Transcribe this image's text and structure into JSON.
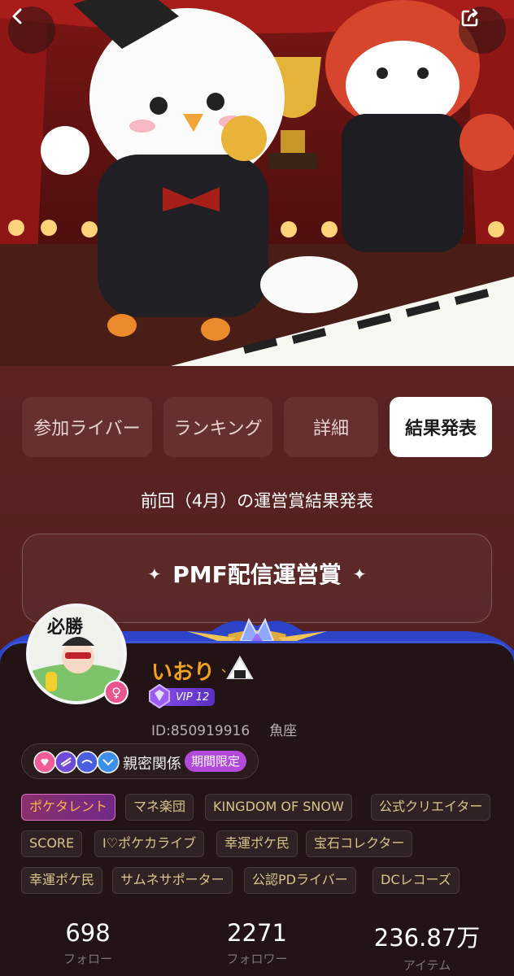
{
  "header": {
    "back_icon": "chevron-left-icon",
    "share_icon": "share-icon"
  },
  "tabs": [
    {
      "label": "参加ライバー",
      "active": false
    },
    {
      "label": "ランキング",
      "active": false
    },
    {
      "label": "詳細",
      "active": false
    },
    {
      "label": "結果発表",
      "active": true
    }
  ],
  "results": {
    "subtitle": "前回（4月）の運営賞結果発表",
    "award_title": "PMF配信運営賞"
  },
  "profile": {
    "avatar_text": "必勝",
    "username": "いおり",
    "vip_label": "VIP 12",
    "id_text": "ID:850919916",
    "zodiac": "魚座",
    "gender_symbol": "♀",
    "relation_label": "親密関係",
    "relation_badge": "期間限定",
    "tags": [
      "ポケタレント",
      "マネ楽団",
      "KINGDOM OF SNOW",
      "公式クリエイター",
      "SCORE",
      "I♡ポケカライブ",
      "幸運ポケ民",
      "宝石コレクター",
      "幸運ポケ民",
      "サムネサポーター",
      "公認PDライバー",
      "DCレコーズ"
    ]
  },
  "stats": [
    {
      "value": "698",
      "label": "フォロー"
    },
    {
      "value": "2271",
      "label": "フォロワー"
    },
    {
      "value": "236.87万",
      "label": "アイテム"
    }
  ],
  "colors": {
    "accent_orange": "#f0a21f",
    "badge_purple": "#b14ad9",
    "tag_text": "#d8c58a"
  }
}
